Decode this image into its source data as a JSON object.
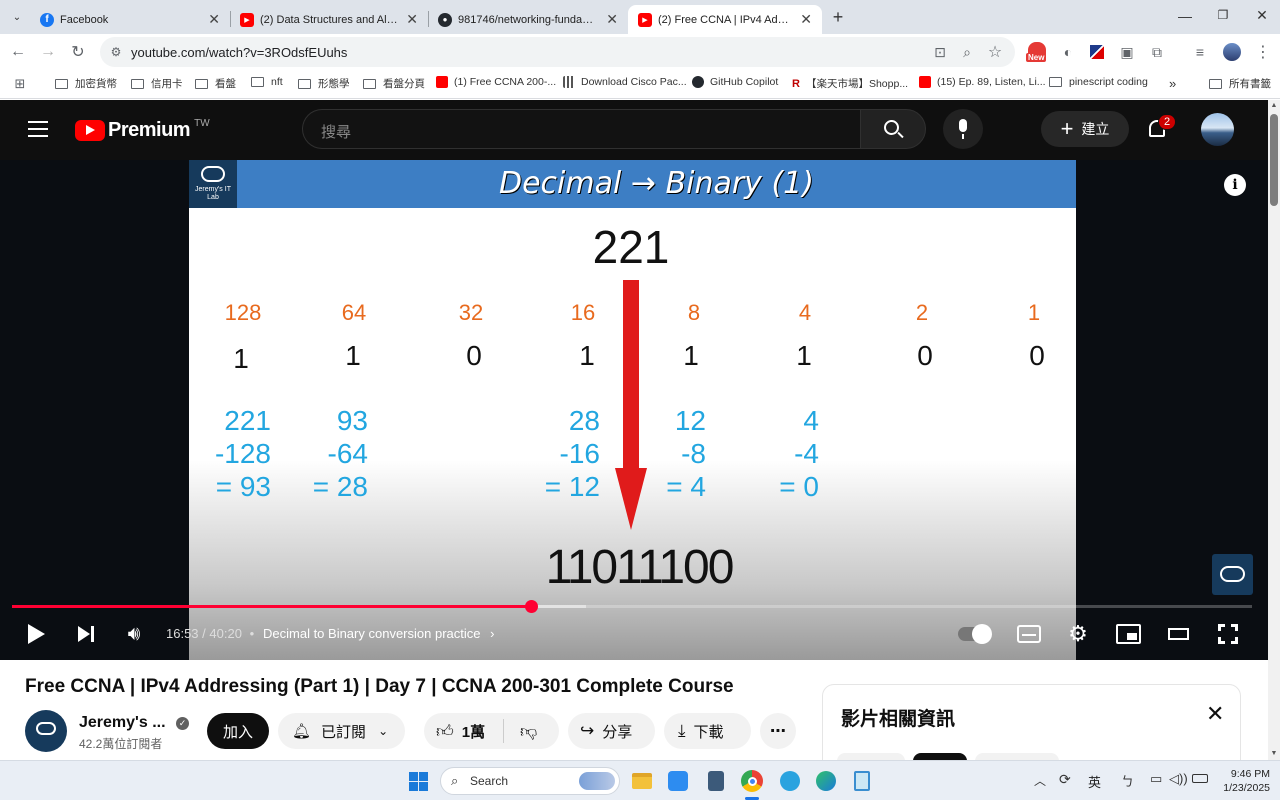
{
  "browser": {
    "tabs": [
      {
        "title": "Facebook",
        "icon": "facebook-icon",
        "color": "#1877f2"
      },
      {
        "title": "(2) Data Structures and Algorith",
        "icon": "youtube-icon",
        "color": "#ff0000"
      },
      {
        "title": "981746/networking-fundament",
        "icon": "github-icon",
        "color": "#24292f"
      },
      {
        "title": "(2) Free CCNA | IPv4 Addressing",
        "icon": "youtube-icon",
        "color": "#ff0000",
        "active": true
      }
    ],
    "url": "youtube.com/watch?v=3ROdsfEUuhs",
    "new_badge": "New",
    "bookmarks": [
      {
        "label": "加密貨幣",
        "type": "folder"
      },
      {
        "label": "信用卡",
        "type": "folder"
      },
      {
        "label": "看盤",
        "type": "folder"
      },
      {
        "label": "nft",
        "type": "folder"
      },
      {
        "label": "形態學",
        "type": "folder"
      },
      {
        "label": "看盤分頁",
        "type": "folder"
      },
      {
        "label": "(1) Free CCNA 200-...",
        "type": "youtube"
      },
      {
        "label": "Download Cisco Pac...",
        "type": "cisco"
      },
      {
        "label": "GitHub Copilot",
        "type": "github"
      },
      {
        "label": "【楽天市場】Shopp...",
        "type": "rakuten"
      },
      {
        "label": "(15) Ep. 89, Listen, Li...",
        "type": "youtube"
      },
      {
        "label": "pinescript coding",
        "type": "folder"
      }
    ],
    "all_bookmarks": "所有書籤"
  },
  "youtube": {
    "logo_text": "Premium",
    "region": "TW",
    "search_placeholder": "搜尋",
    "create_label": "建立",
    "notif_count": "2"
  },
  "video": {
    "slide_title": "Decimal → Binary (1)",
    "slide_logo": "Jeremy's IT Lab",
    "decimal": "221",
    "place_values": [
      "128",
      "64",
      "32",
      "16",
      "8",
      "4",
      "2",
      "1"
    ],
    "bits": [
      "1",
      "1",
      "0",
      "1",
      "1",
      "1",
      "0",
      "0"
    ],
    "calcs": [
      {
        "a": "221",
        "b": "-128",
        "c": "= 93"
      },
      {
        "a": "93",
        "b": "-64",
        "c": "= 28"
      },
      {
        "a": "28",
        "b": "-16",
        "c": "= 12"
      },
      {
        "a": "12",
        "b": "-8",
        "c": "= 4"
      },
      {
        "a": "4",
        "b": "-4",
        "c": "= 0"
      }
    ],
    "binary": "11011100",
    "time_current": "16:53",
    "time_total": "40:20",
    "time_sep": "/",
    "chapter": "Decimal to Binary conversion practice",
    "progress": 0.4186,
    "buffered": 0.463,
    "accent": "#ff0033"
  },
  "page": {
    "title": "Free CCNA | IPv4 Addressing (Part 1) | Day 7 | CCNA 200-301 Complete Course",
    "channel": "Jeremy's ...",
    "subs": "42.2萬位訂閱者",
    "join": "加入",
    "subscribed": "已訂閱",
    "likes": "1萬",
    "share": "分享",
    "download": "下載",
    "panel_title": "影片相關資訊"
  },
  "taskbar": {
    "search": "Search",
    "ime": "英",
    "time": "9:46 PM",
    "date": "1/23/2025"
  }
}
